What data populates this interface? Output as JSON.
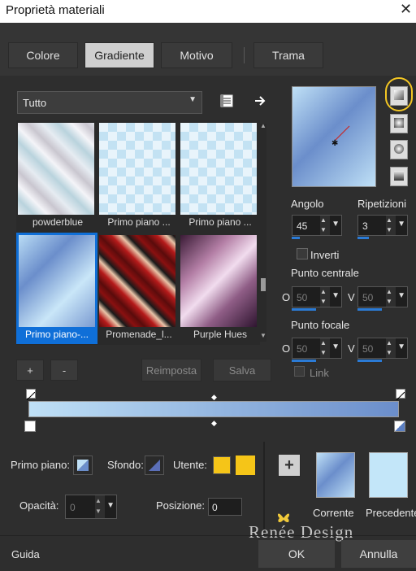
{
  "window": {
    "title": "Proprietà materiali",
    "close": "✕"
  },
  "tabs": [
    {
      "label": "Colore",
      "active": false
    },
    {
      "label": "Gradiente",
      "active": true
    },
    {
      "label": "Motivo",
      "active": false
    },
    {
      "label": "Trama",
      "active": false
    }
  ],
  "category": {
    "value": "Tutto"
  },
  "gradients": [
    {
      "name": "powderblue"
    },
    {
      "name": "Primo piano ..."
    },
    {
      "name": "Primo piano ..."
    },
    {
      "name": "Primo piano-...",
      "selected": true
    },
    {
      "name": "Promenade_l..."
    },
    {
      "name": "Purple Hues"
    }
  ],
  "buttons": {
    "add": "+",
    "remove": "-",
    "reset": "Reimposta",
    "save": "Salva"
  },
  "angle": {
    "label": "Angolo",
    "value": "45"
  },
  "repeats": {
    "label": "Ripetizioni",
    "value": "3"
  },
  "invert": {
    "label": "Inverti",
    "checked": false
  },
  "center": {
    "label": "Punto centrale",
    "h_label": "O",
    "h_value": "50",
    "v_label": "V",
    "v_value": "50"
  },
  "focal": {
    "label": "Punto focale",
    "h_label": "O",
    "h_value": "50",
    "v_label": "V",
    "v_value": "50"
  },
  "link": {
    "label": "Link"
  },
  "bottom": {
    "foreground_label": "Primo piano:",
    "background_label": "Sfondo:",
    "user_label": "Utente:",
    "opacity_label": "Opacità:",
    "opacity_value": "0",
    "position_label": "Posizione:",
    "position_value": "0",
    "current_label": "Corrente",
    "previous_label": "Precedente"
  },
  "footer": {
    "help": "Guida",
    "ok": "OK",
    "cancel": "Annulla"
  },
  "watermark": "Renée Design",
  "colors": {
    "accent": "#0f6fd8",
    "user_color": "#f5c518",
    "highlight_ring": "#f3c623"
  }
}
